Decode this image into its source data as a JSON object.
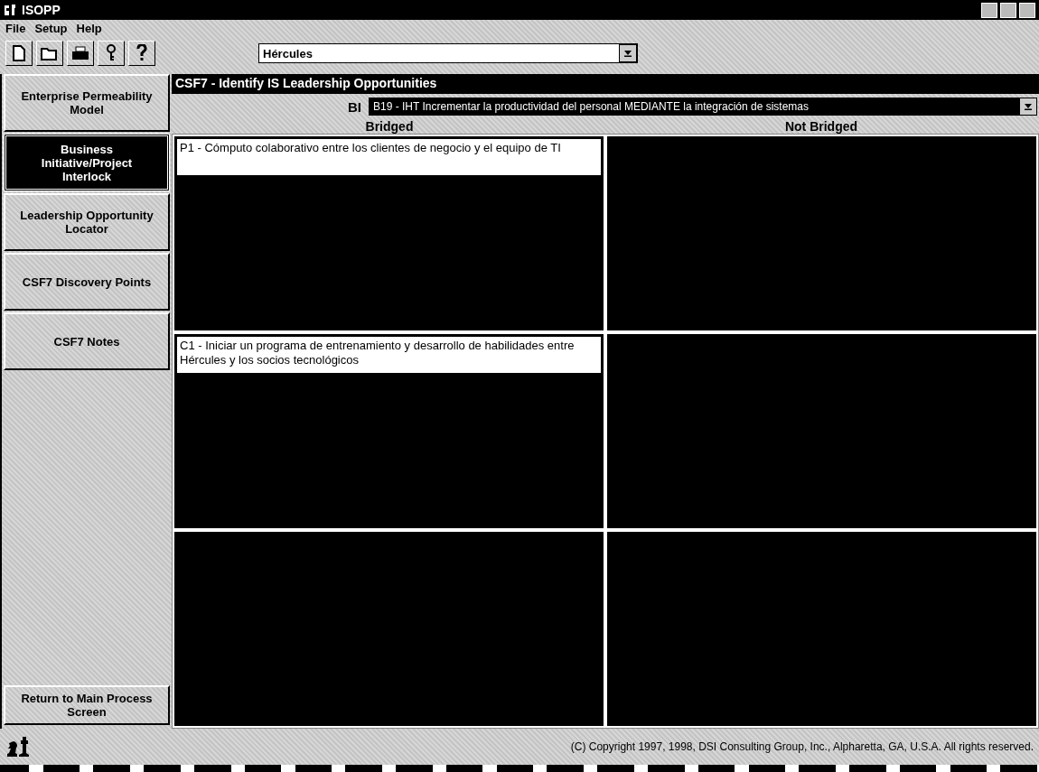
{
  "window": {
    "title": "ISOPP"
  },
  "menu": [
    "File",
    "Setup",
    "Help"
  ],
  "toolbar": {
    "company": "Hércules"
  },
  "sidebar": {
    "items": [
      {
        "label": "Enterprise Permeability Model",
        "selected": false
      },
      {
        "label": "Business Initiative/Project Interlock",
        "selected": true
      },
      {
        "label": "Leadership Opportunity Locator",
        "selected": false
      },
      {
        "label": "CSF7 Discovery Points",
        "selected": false
      },
      {
        "label": "CSF7 Notes",
        "selected": false
      }
    ],
    "return_button": "Return to Main Process Screen"
  },
  "header": "CSF7 - Identify IS Leadership Opportunities",
  "bi": {
    "label": "BI",
    "value": "B19 - IHT Incrementar la productividad del personal MEDIANTE la integración de sistemas"
  },
  "columns": [
    "Bridged",
    "Not Bridged"
  ],
  "rows": [
    {
      "bridged": "P1 - Cómputo colaborativo entre los clientes de negocio y el equipo de TI"
    },
    {
      "bridged": "C1 - Iniciar un programa de entrenamiento y desarrollo de habilidades entre Hércules y los socios tecnológicos"
    },
    {}
  ],
  "status_bar": {
    "copyright": "(C) Copyright 1997, 1998, DSI Consulting Group, Inc., Alpharetta, GA, U.S.A. All rights reserved."
  }
}
